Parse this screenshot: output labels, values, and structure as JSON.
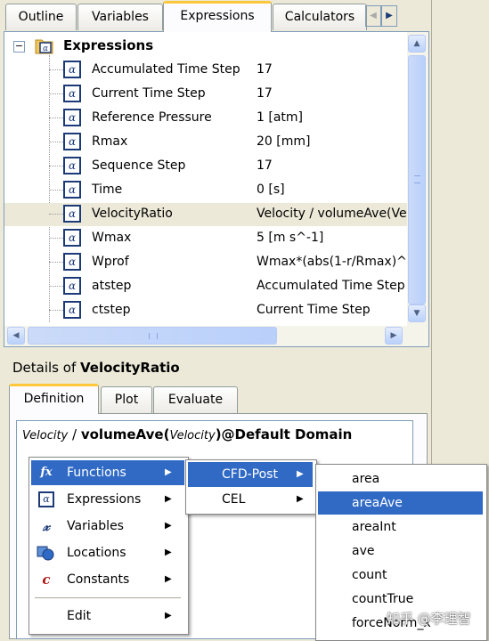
{
  "tabs": [
    "Outline",
    "Variables",
    "Expressions",
    "Calculators"
  ],
  "tree": {
    "root_label": "Expressions",
    "items": [
      {
        "name": "Accumulated Time Step",
        "value": "17"
      },
      {
        "name": "Current Time Step",
        "value": "17"
      },
      {
        "name": "Reference Pressure",
        "value": "1 [atm]"
      },
      {
        "name": "Rmax",
        "value": "20 [mm]"
      },
      {
        "name": "Sequence Step",
        "value": "17"
      },
      {
        "name": "Time",
        "value": "0 [s]"
      },
      {
        "name": "VelocityRatio",
        "value": "Velocity / volumeAve(Ve",
        "selected": true
      },
      {
        "name": "Wmax",
        "value": "5 [m s^-1]"
      },
      {
        "name": "Wprof",
        "value": "Wmax*(abs(1-r/Rmax)^"
      },
      {
        "name": "atstep",
        "value": "Accumulated Time Step"
      },
      {
        "name": "ctstep",
        "value": "Current Time Step"
      }
    ]
  },
  "details": {
    "prefix": "Details of ",
    "name": "VelocityRatio",
    "tabs": [
      "Definition",
      "Plot",
      "Evaluate"
    ],
    "definition": {
      "part1": "Velocity",
      "part2": " / ",
      "part3": "volumeAve(",
      "part4": "Velocity",
      "part5": ")@Default Domain"
    }
  },
  "context_menu": {
    "items": [
      "Functions",
      "Expressions",
      "Variables",
      "Locations",
      "Constants",
      "Edit"
    ],
    "icons": [
      "fx-icon",
      "expression-icon",
      "variable-icon",
      "location-icon",
      "constant-icon"
    ]
  },
  "submenu": {
    "items": [
      "CFD-Post",
      "CEL"
    ]
  },
  "function_list": {
    "items": [
      "area",
      "areaAve",
      "areaInt",
      "ave",
      "count",
      "countTrue",
      "forceNorm_x"
    ],
    "highlighted": "areaAve"
  },
  "watermark": "知乎 @李理智",
  "colors": {
    "highlight": "#316ac5",
    "tab_accent": "#ffc83c",
    "icon_blue": "#1c3a78"
  }
}
